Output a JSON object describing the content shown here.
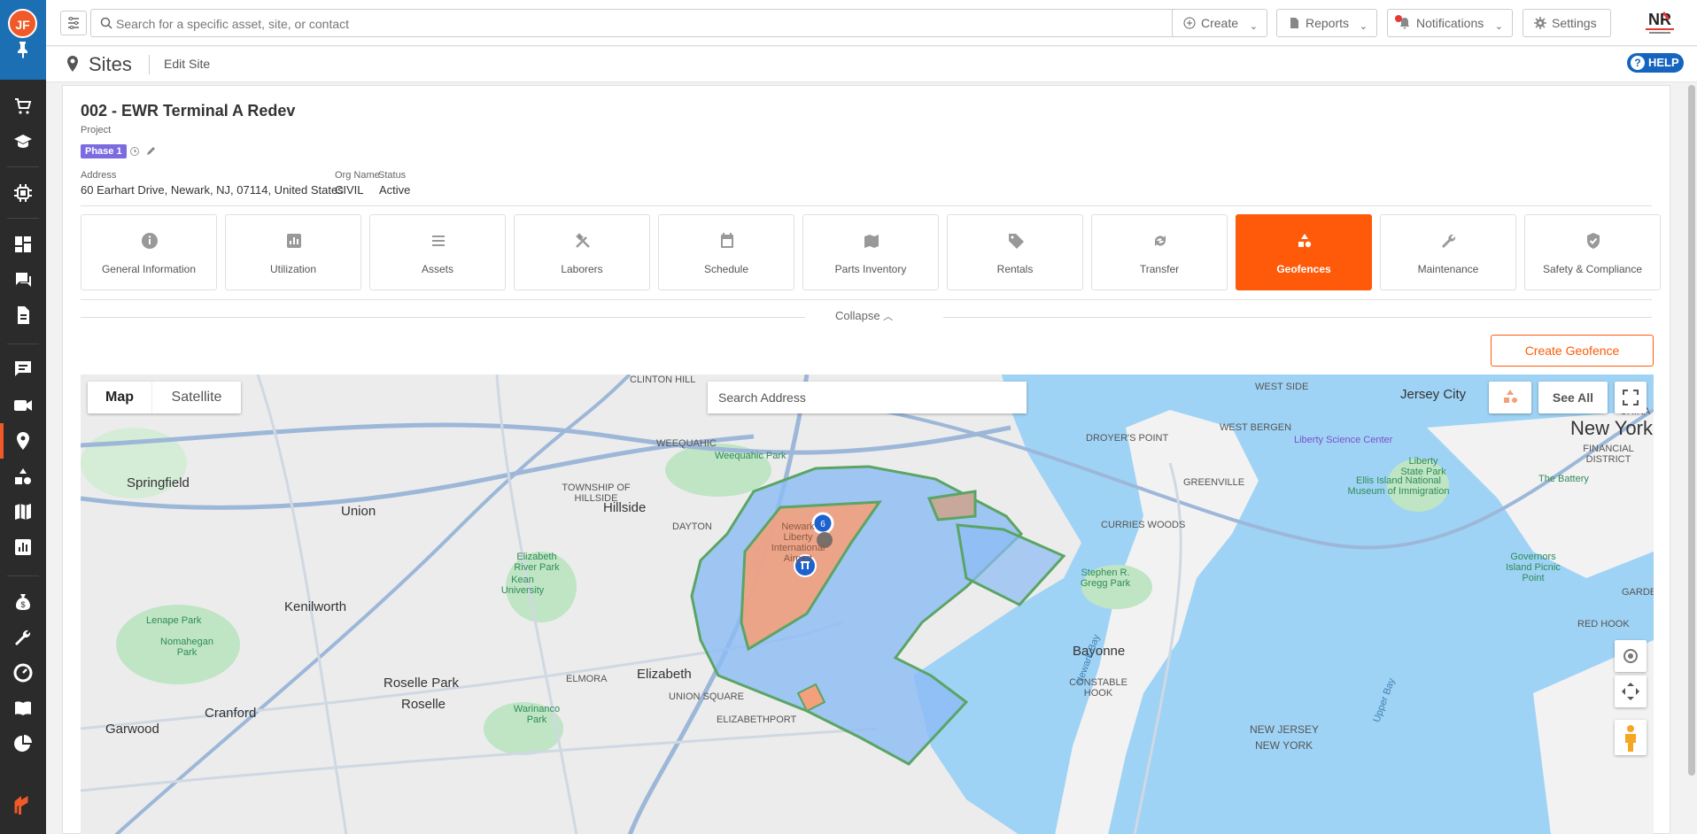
{
  "user": {
    "initials": "JF"
  },
  "topbar": {
    "search_placeholder": "Search for a specific asset, site, or contact",
    "create_label": "Create",
    "reports_label": "Reports",
    "notifications_label": "Notifications",
    "settings_label": "Settings",
    "logo_text": "NR"
  },
  "breadcrumb": {
    "section": "Sites",
    "page": "Edit Site",
    "help_label": "HELP"
  },
  "site": {
    "title": "002 - EWR Terminal A Redev",
    "type": "Project",
    "phase": "Phase 1",
    "address_label": "Address",
    "address": "60 Earhart Drive, Newark, NJ, 07114, United States",
    "org_label": "Org Name",
    "org": "CIVIL",
    "status_label": "Status",
    "status": "Active"
  },
  "tabs": [
    {
      "label": "General Information",
      "icon": "info-icon"
    },
    {
      "label": "Utilization",
      "icon": "bar-chart-icon"
    },
    {
      "label": "Assets",
      "icon": "list-icon"
    },
    {
      "label": "Laborers",
      "icon": "tools-icon"
    },
    {
      "label": "Schedule",
      "icon": "calendar-icon"
    },
    {
      "label": "Parts Inventory",
      "icon": "parts-icon"
    },
    {
      "label": "Rentals",
      "icon": "tag-icon"
    },
    {
      "label": "Transfer",
      "icon": "transfer-icon"
    },
    {
      "label": "Geofences",
      "icon": "shapes-icon",
      "active": true
    },
    {
      "label": "Maintenance",
      "icon": "wrench-icon"
    },
    {
      "label": "Safety & Compliance",
      "icon": "shield-icon"
    }
  ],
  "collapse_label": "Collapse",
  "create_geofence_label": "Create Geofence",
  "map": {
    "type_map": "Map",
    "type_satellite": "Satellite",
    "search_placeholder": "Search Address",
    "see_all": "See All",
    "cluster_count": "6",
    "places": {
      "jersey_city": "Jersey City",
      "new_york": "New York",
      "springfield": "Springfield",
      "union": "Union",
      "hillside": "Hillside",
      "dayton": "DAYTON",
      "weequahic": "WEEQUAHIC",
      "weequahic_park": "Weequahic Park",
      "township_hillside": "TOWNSHIP OF HILLSIDE",
      "clinton_hill": "CLINTON HILL",
      "west_side": "WEST SIDE",
      "droyers_point": "DROYER'S POINT",
      "west_bergen": "WEST BERGEN",
      "greenville": "GREENVILLE",
      "curries_woods": "CURRIES WOODS",
      "liberty_science": "Liberty Science Center",
      "liberty_state_park": "Liberty State Park",
      "ellis_island": "Ellis Island National Museum of Immigration",
      "the_battery": "The Battery",
      "financial_district": "FINANCIAL DISTRICT",
      "governors_island": "Governors Island Picnic Point",
      "stephen_gregg": "Stephen R. Gregg Park",
      "bayonne": "Bayonne",
      "constable_hook": "CONSTABLE HOOK",
      "red_hook": "RED HOOK",
      "kenilworth": "Kenilworth",
      "lenape_park": "Lenape Park",
      "nomahegan_park": "Nomahegan Park",
      "elizabeth_river_park": "Elizabeth River Park",
      "kean_university": "Kean University",
      "roselle_park": "Roselle Park",
      "roselle": "Roselle",
      "cranford": "Cranford",
      "garwood": "Garwood",
      "elizabeth": "Elizabeth",
      "elmora": "ELMORA",
      "union_square": "UNION SQUARE",
      "elizabethport": "ELIZABETHPORT",
      "warinanco_park": "Warinanco Park",
      "newark_liberty": "Newark Liberty International Airport",
      "new_jersey": "NEW JERSEY",
      "new_york_label": "NEW YORK",
      "newark_bay": "Newark Bay",
      "upper_bay": "Upper Bay",
      "china": "CHINA",
      "garde": "GARDE"
    }
  },
  "colors": {
    "accent": "#ff5a0a",
    "rail": "#2b2b2b",
    "rail_top": "#1d6fb3",
    "phase": "#7b6ae0",
    "help": "#1565c0",
    "water": "#9fd3f5",
    "geofence_blue": "#8cbcf5",
    "geofence_orange": "#f4a07c",
    "geofence_border": "#5aa564"
  }
}
